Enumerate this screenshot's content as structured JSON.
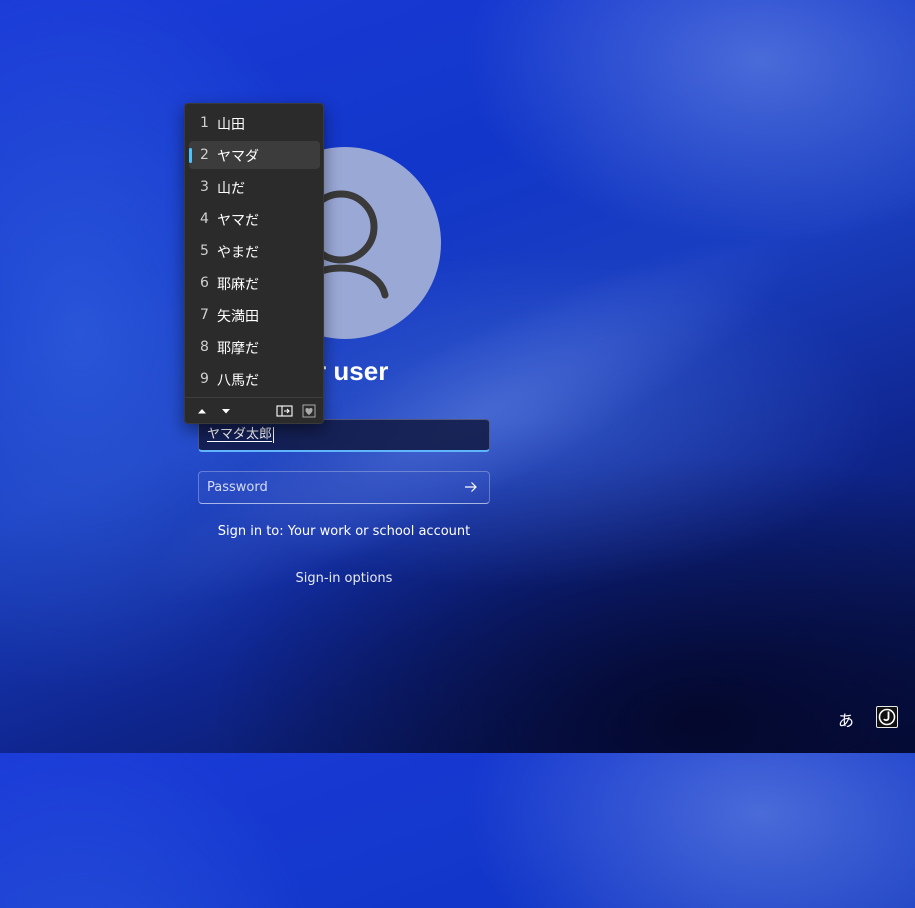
{
  "user": {
    "name_visible": "er user"
  },
  "username_field": {
    "value": "ヤマダ太郎"
  },
  "password_field": {
    "placeholder": "Password"
  },
  "sign_in_to": "Sign in to: Your work or school account",
  "sign_in_options": "Sign-in options",
  "ime_candidates": {
    "items": [
      {
        "num": "1",
        "text": "山田"
      },
      {
        "num": "2",
        "text": "ヤマダ"
      },
      {
        "num": "3",
        "text": "山だ"
      },
      {
        "num": "4",
        "text": "ヤマだ"
      },
      {
        "num": "5",
        "text": "やまだ"
      },
      {
        "num": "6",
        "text": "耶麻だ"
      },
      {
        "num": "7",
        "text": "矢満田"
      },
      {
        "num": "8",
        "text": "耶摩だ"
      },
      {
        "num": "9",
        "text": "八馬だ"
      }
    ],
    "selected_index": 1
  },
  "tray": {
    "ime_mode": "あ"
  },
  "colors": {
    "accent": "#4cc2ff",
    "popup_bg": "#2b2b2b"
  }
}
